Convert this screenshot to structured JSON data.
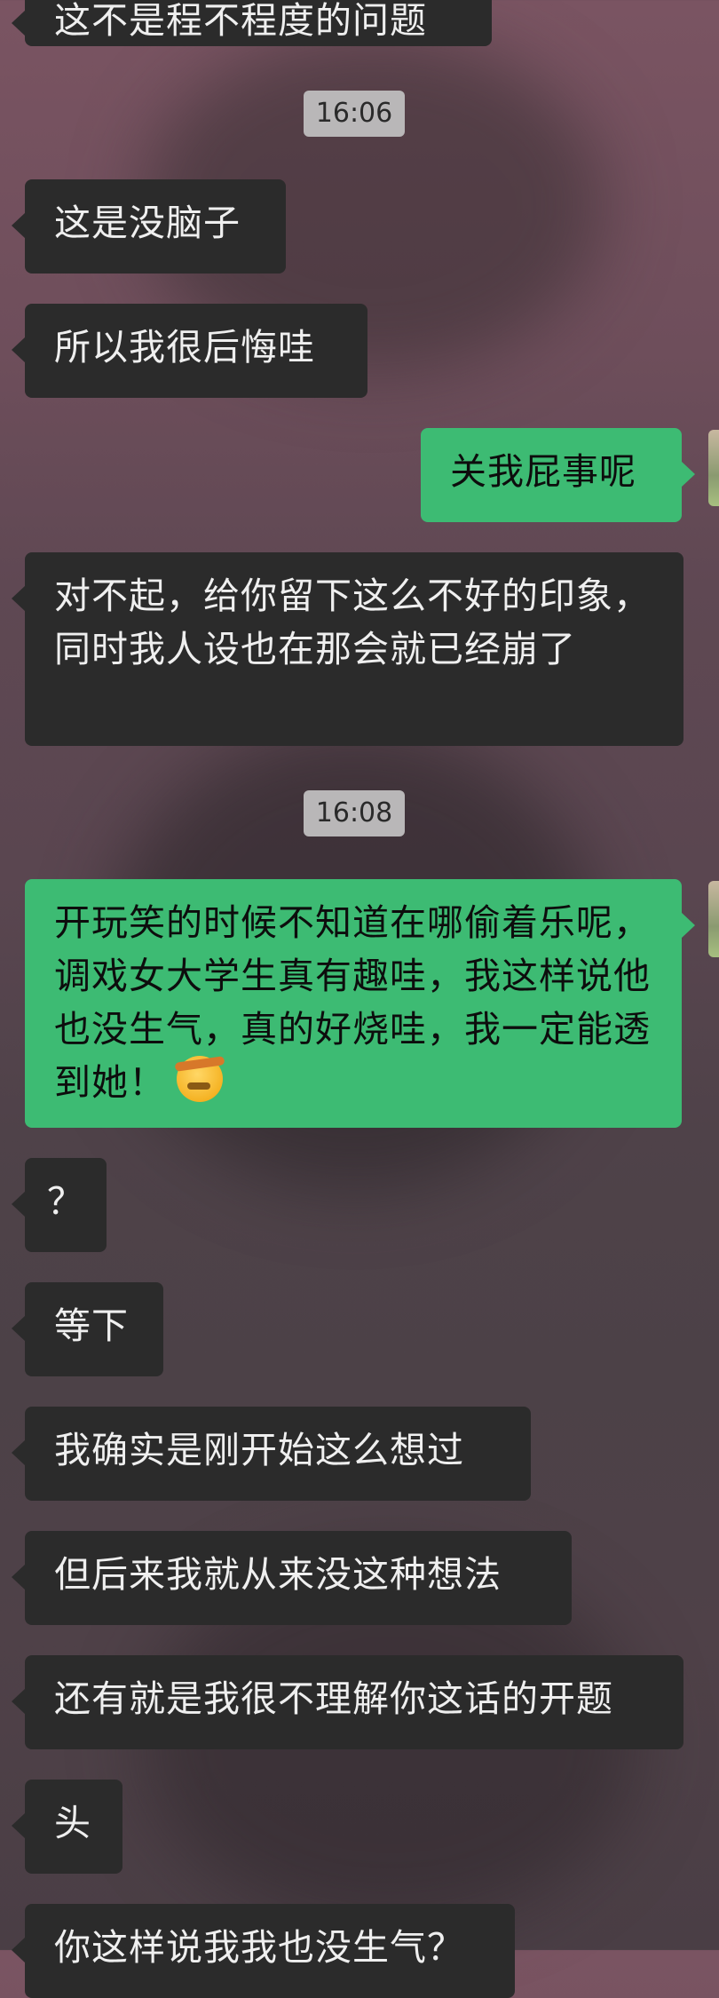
{
  "chat": {
    "timestamps": [
      "16:06",
      "16:08"
    ],
    "messages": [
      {
        "side": "left",
        "text": "这不是程不程度的问题"
      },
      {
        "side": "left",
        "text": "这是没脑子"
      },
      {
        "side": "left",
        "text": "所以我很后悔哇"
      },
      {
        "side": "right",
        "text": "关我屁事呢"
      },
      {
        "side": "left",
        "text": "对不起，给你留下这么不好的印象，同时我人设也在那会就已经崩了"
      },
      {
        "side": "right",
        "text": "开玩笑的时候不知道在哪偷着乐呢，调戏女大学生真有趣哇，我这样说他也没生气，真的好烧哇，我一定能透到她！",
        "emoji": "saluting-face-emoji"
      },
      {
        "side": "left",
        "text": "？"
      },
      {
        "side": "left",
        "text": "等下"
      },
      {
        "side": "left",
        "text": "我确实是刚开始这么想过"
      },
      {
        "side": "left",
        "text": "但后来我就从来没这种想法"
      },
      {
        "side": "left",
        "text": "还有就是我很不理解你这话的开题"
      },
      {
        "side": "left",
        "text": "头"
      },
      {
        "side": "left",
        "text": "你这样说我我也没生气？"
      }
    ]
  },
  "colors": {
    "left_bubble": "#2b2b2b",
    "right_bubble": "#3dbb73",
    "timestamp_bg": "#b9b7b8"
  }
}
